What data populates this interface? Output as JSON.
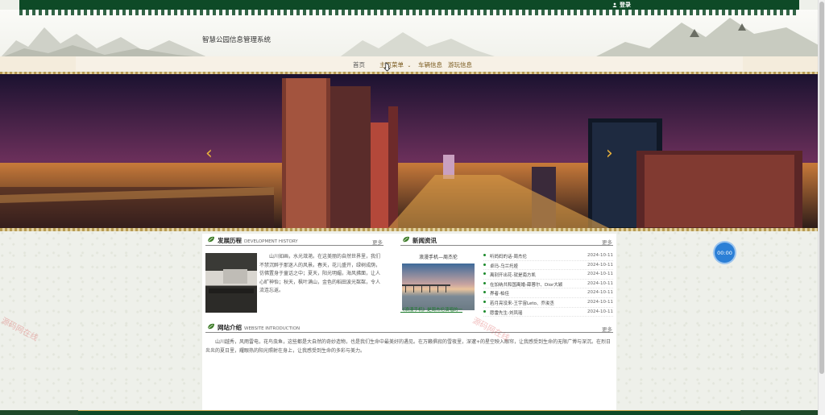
{
  "header": {
    "login_label": "登录",
    "site_title": "智慧公园信息管理系统"
  },
  "nav": {
    "items": [
      {
        "label": "首页"
      },
      {
        "label": "主页菜单"
      },
      {
        "label": "车辆信息"
      },
      {
        "label": "游玩信息"
      }
    ]
  },
  "history": {
    "title": "发展历程",
    "subtitle": "DEVELOPMENT HISTORY",
    "more": "更多",
    "text": "山川如画，水光潋滟。在这美丽的自然世界里，我们不禁沉醉于那迷人的风景。春天，花儿盛开，绿树成荫，仿佛置身于童话之中；夏天，阳光明媚，海风拂面，让人心旷神怡；秋天，枫叶满山，金色的稻田波光粼粼，令人流连忘返。"
  },
  "news": {
    "title": "新闻资讯",
    "more": "更多",
    "featured_title": "浪漫手机—周杰伦",
    "featured_caption": "《浪漫手机》是周杰伦演唱的一",
    "items": [
      {
        "title": "听妈妈的话-周杰伦",
        "date": "2024-10-11"
      },
      {
        "title": "卓玛-乌兰托娅",
        "date": "2024-10-11"
      },
      {
        "title": "离别开出花-就是南方凯",
        "date": "2024-10-11"
      },
      {
        "title": "在加纳共和国离婚-薛蓉尔、Dior大颖",
        "date": "2024-10-11"
      },
      {
        "title": "界者-柏佳",
        "date": "2024-10-11"
      },
      {
        "title": "若月亮没来-王宇宙Leto、乔浚丞",
        "date": "2024-10-11"
      },
      {
        "title": "愿雷先生-刘凤瑶",
        "date": "2024-10-11"
      }
    ]
  },
  "intro": {
    "title": "网站介绍",
    "subtitle": "WEBSITE INTRODUCTION",
    "more": "更多",
    "text": "山川越秀，风雨雷电，花鸟虫鱼，这些都是大自然的奇妙造物，也是我们生命中最美好的遇见。在万籁俱寂的雪夜里，深邃+的星空映入眼帘，让我感受到生命的无限广博与深沉。在烈日炎炎的夏日里，耀眼热的阳光照射在身上，让我感受到生命的多彩与美力。"
  },
  "timer": {
    "value": "00:00"
  },
  "watermarks": [
    "源码网在线",
    "源码网在线"
  ],
  "colors": {
    "header_green": "#0e4a27",
    "nav_gold": "#7a5a1e",
    "accent_green": "#1b8a2b",
    "timer_blue": "#2b7fd6"
  }
}
